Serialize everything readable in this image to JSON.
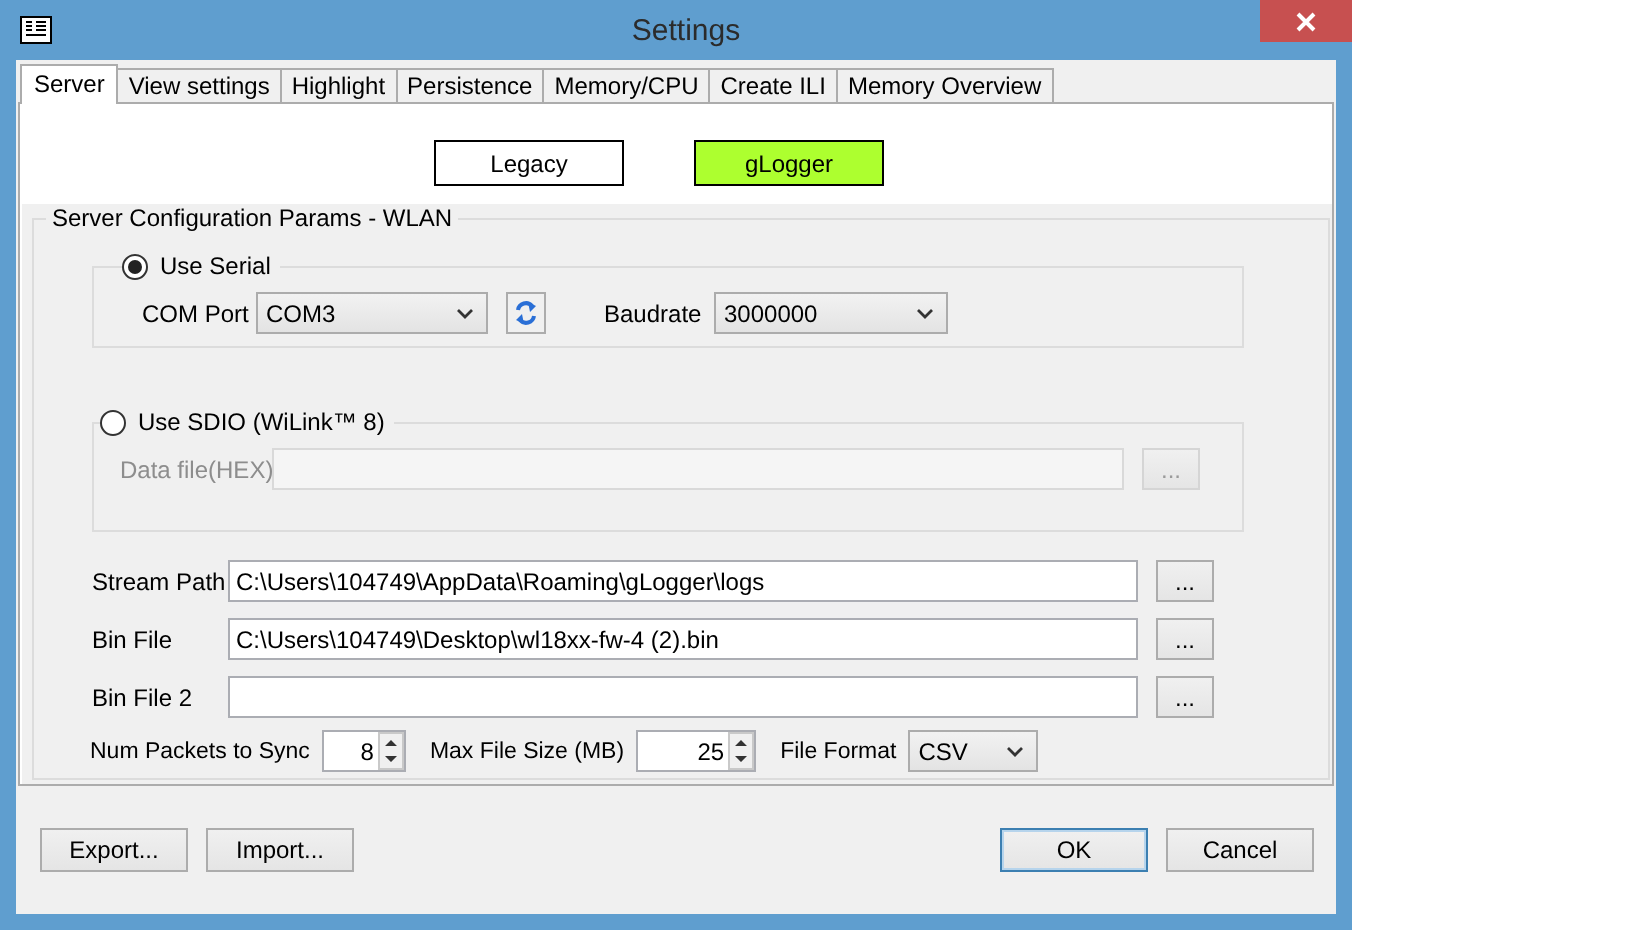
{
  "window": {
    "title": "Settings"
  },
  "tabs": [
    {
      "label": "Server",
      "selected": true
    },
    {
      "label": "View settings",
      "selected": false
    },
    {
      "label": "Highlight",
      "selected": false
    },
    {
      "label": "Persistence",
      "selected": false
    },
    {
      "label": "Memory/CPU",
      "selected": false
    },
    {
      "label": "Create ILI",
      "selected": false
    },
    {
      "label": "Memory Overview",
      "selected": false
    }
  ],
  "modes": [
    {
      "label": "Legacy",
      "selected": false
    },
    {
      "label": "gLogger",
      "selected": true
    }
  ],
  "server_config": {
    "title": "Server Configuration Params - WLAN",
    "serial": {
      "label": "Use Serial",
      "selected": true,
      "com_port": {
        "label": "COM Port",
        "value": "COM3"
      },
      "baudrate": {
        "label": "Baudrate",
        "value": "3000000"
      }
    },
    "sdio": {
      "label": "Use SDIO (WiLink™ 8)",
      "selected": false,
      "data_file": {
        "label": "Data file(HEX)",
        "disabled": true,
        "browse": "..."
      }
    },
    "paths": [
      {
        "label": "Stream Path",
        "value": "C:\\Users\\104749\\AppData\\Roaming\\gLogger\\logs",
        "browse": "..."
      },
      {
        "label": "Bin File",
        "value": "C:\\Users\\104749\\Desktop\\wl18xx-fw-4 (2).bin",
        "browse": "..."
      },
      {
        "label": "Bin File 2",
        "browse": "..."
      }
    ],
    "options": [
      {
        "kind": "spinner",
        "label": "Num Packets to Sync",
        "value": "8"
      },
      {
        "kind": "spinner",
        "label": "Max File Size (MB)",
        "value": "25"
      },
      {
        "kind": "dropdown",
        "label": "File Format",
        "value": "CSV"
      }
    ]
  },
  "footer": {
    "left_buttons": [
      {
        "label": "Export...",
        "default": false
      },
      {
        "label": "Import...",
        "default": false
      }
    ],
    "right_buttons": [
      {
        "label": "OK",
        "default": true
      },
      {
        "label": "Cancel",
        "default": false
      }
    ]
  }
}
